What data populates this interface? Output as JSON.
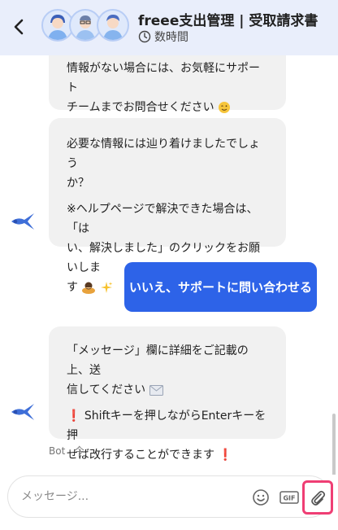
{
  "header": {
    "title": "freee支出管理 | 受取請求書",
    "response_time": "数時間"
  },
  "messages": {
    "m1_line1": "情報がない場合には、お気軽にサポート",
    "m1_line2": "チームまでお問合せください",
    "m2_line1": "必要な情報には辿り着けましたでしょう",
    "m2_line2": "か？",
    "m2_line3": "※ヘルプページで解決できた場合は、「は",
    "m2_line4": "い、解決しました」のクリックをお願いしま",
    "m2_line5": "す",
    "user_reply": "いいえ、サポートに問い合わせる",
    "m3_line1": "「メッセージ」欄に詳細をご記載の上、送",
    "m3_line2": "信してください",
    "m3_line3": "Shiftキーを押しながらEnterキーを押",
    "m3_line4": "せば改行することができます",
    "meta": "Bot · 今."
  },
  "composer": {
    "placeholder": "メッセージ...",
    "gif_label": "GIF"
  },
  "icons": {
    "back": "chevron-left-icon",
    "clock": "clock-icon",
    "emoji": "smiley-icon",
    "gif": "gif-icon",
    "attach": "paperclip-icon",
    "bot": "bird-logo-icon"
  },
  "colors": {
    "header_bg": "#e9eefb",
    "user_bubble": "#2d63e8",
    "bot_bubble": "#f1f1f1",
    "highlight": "#ef3e74",
    "exclamation": "#e02424"
  }
}
